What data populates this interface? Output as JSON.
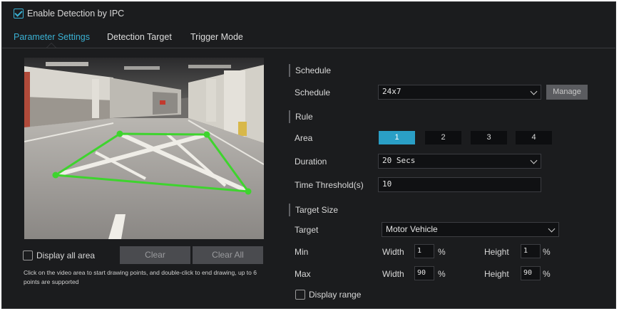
{
  "header": {
    "enable_label": "Enable Detection by IPC",
    "enable_checked": true
  },
  "tabs": [
    {
      "label": "Parameter Settings",
      "active": true
    },
    {
      "label": "Detection Target",
      "active": false
    },
    {
      "label": "Trigger Mode",
      "active": false
    }
  ],
  "preview": {
    "display_all_area_label": "Display all area",
    "clear_label": "Clear",
    "clear_all_label": "Clear All",
    "hint": "Click on the video area to start drawing points, and double-click to end drawing, up to 6 points are supported"
  },
  "schedule": {
    "section_title": "Schedule",
    "schedule_label": "Schedule",
    "schedule_value": "24x7",
    "manage_label": "Manage"
  },
  "rule": {
    "section_title": "Rule",
    "area_label": "Area",
    "area_options": [
      "1",
      "2",
      "3",
      "4"
    ],
    "area_selected": "1",
    "duration_label": "Duration",
    "duration_value": "20 Secs",
    "threshold_label": "Time Threshold(s)",
    "threshold_value": "10"
  },
  "target_size": {
    "section_title": "Target Size",
    "target_label": "Target",
    "target_value": "Motor Vehicle",
    "min_label": "Min",
    "max_label": "Max",
    "width_label": "Width",
    "height_label": "Height",
    "percent": "%",
    "min_width": "1",
    "min_height": "1",
    "max_width": "90",
    "max_height": "90",
    "display_range_label": "Display range"
  },
  "colors": {
    "accent": "#3ab0d2",
    "detection_zone": "#3ed42e",
    "panel_bg": "#1b1c1e"
  }
}
